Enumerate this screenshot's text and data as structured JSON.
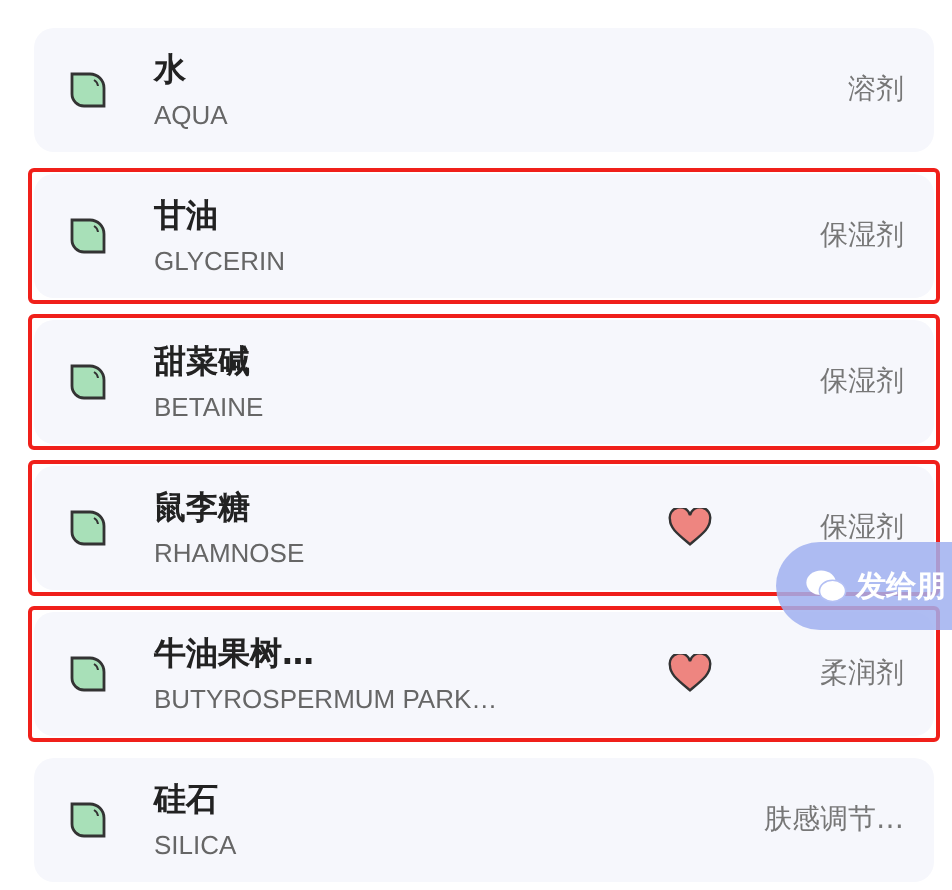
{
  "ingredients": [
    {
      "name": "水",
      "inci": "AQUA",
      "role": "溶剂",
      "favorite": false,
      "highlighted": false
    },
    {
      "name": "甘油",
      "inci": "GLYCERIN",
      "role": "保湿剂",
      "favorite": false,
      "highlighted": true
    },
    {
      "name": "甜菜碱",
      "inci": "BETAINE",
      "role": "保湿剂",
      "favorite": false,
      "highlighted": true
    },
    {
      "name": "鼠李糖",
      "inci": "RHAMNOSE",
      "role": "保湿剂",
      "favorite": true,
      "highlighted": true
    },
    {
      "name": "牛油果树…",
      "inci": "BUTYROSPERMUM PARK…",
      "role": "柔润剂",
      "favorite": true,
      "highlighted": true
    },
    {
      "name": "硅石",
      "inci": "SILICA",
      "role": "肤感调节…",
      "favorite": false,
      "highlighted": false
    }
  ],
  "share_button": {
    "label": "发给朋"
  }
}
